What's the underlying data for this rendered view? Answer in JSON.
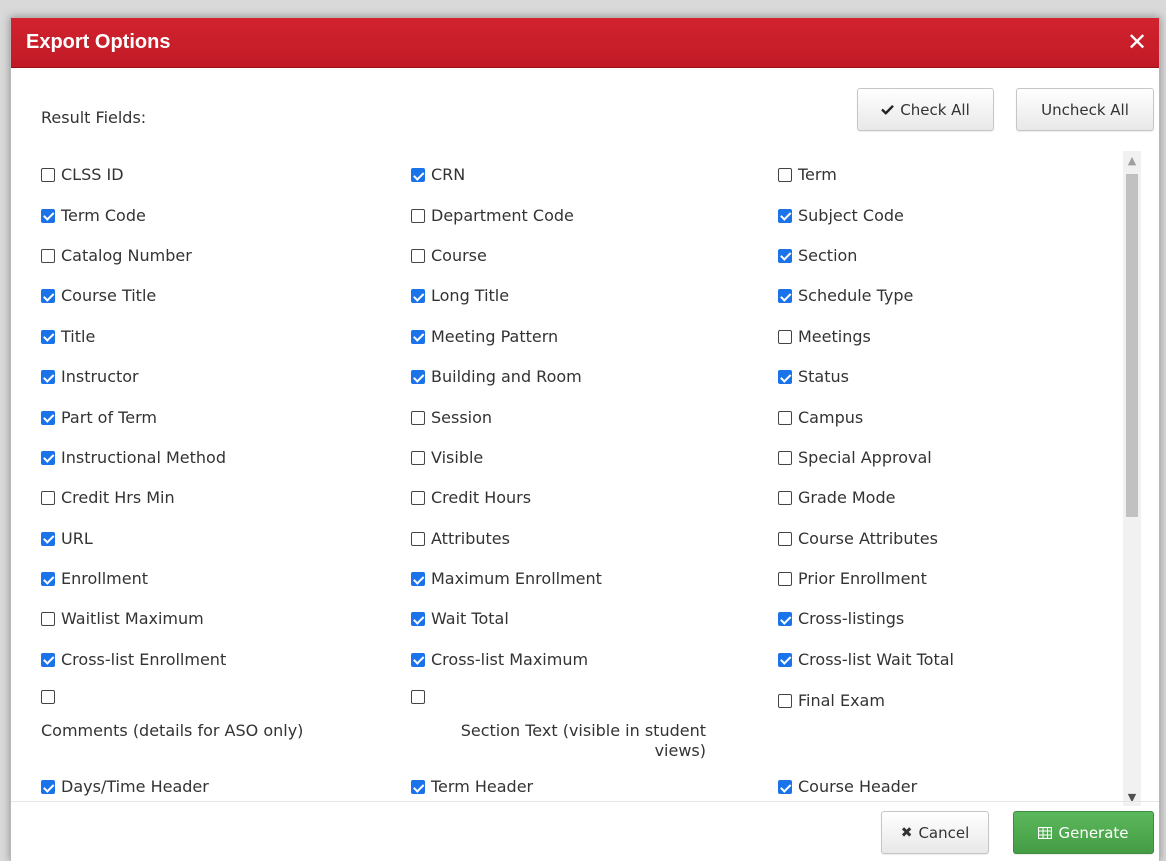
{
  "dialog": {
    "title": "Export Options",
    "close_glyph": "✕",
    "result_fields_label": "Result Fields:",
    "check_all_label": "Check All",
    "uncheck_all_label": "Uncheck All",
    "cancel_label": "Cancel",
    "generate_label": "Generate",
    "header_color": "#c8202c",
    "generate_color": "#4cae4c"
  },
  "fields": [
    {
      "label": "CLSS ID",
      "checked": false
    },
    {
      "label": "CRN",
      "checked": true
    },
    {
      "label": "Term",
      "checked": false
    },
    {
      "label": "Term Code",
      "checked": true
    },
    {
      "label": "Department Code",
      "checked": false
    },
    {
      "label": "Subject Code",
      "checked": true
    },
    {
      "label": "Catalog Number",
      "checked": false
    },
    {
      "label": "Course",
      "checked": false
    },
    {
      "label": "Section",
      "checked": true
    },
    {
      "label": "Course Title",
      "checked": true
    },
    {
      "label": "Long Title",
      "checked": true
    },
    {
      "label": "Schedule Type",
      "checked": true
    },
    {
      "label": "Title",
      "checked": true
    },
    {
      "label": "Meeting Pattern",
      "checked": true
    },
    {
      "label": "Meetings",
      "checked": false
    },
    {
      "label": "Instructor",
      "checked": true
    },
    {
      "label": "Building and Room",
      "checked": true
    },
    {
      "label": "Status",
      "checked": true
    },
    {
      "label": "Part of Term",
      "checked": true
    },
    {
      "label": "Session",
      "checked": false
    },
    {
      "label": "Campus",
      "checked": false
    },
    {
      "label": "Instructional Method",
      "checked": true
    },
    {
      "label": "Visible",
      "checked": false
    },
    {
      "label": "Special Approval",
      "checked": false
    },
    {
      "label": "Credit Hrs Min",
      "checked": false
    },
    {
      "label": "Credit Hours",
      "checked": false
    },
    {
      "label": "Grade Mode",
      "checked": false
    },
    {
      "label": "URL",
      "checked": true
    },
    {
      "label": "Attributes",
      "checked": false
    },
    {
      "label": "Course Attributes",
      "checked": false
    },
    {
      "label": "Enrollment",
      "checked": true
    },
    {
      "label": "Maximum Enrollment",
      "checked": true
    },
    {
      "label": "Prior Enrollment",
      "checked": false
    },
    {
      "label": "Waitlist Maximum",
      "checked": false
    },
    {
      "label": "Wait Total",
      "checked": true
    },
    {
      "label": "Cross-listings",
      "checked": true
    },
    {
      "label": "Cross-list Enrollment",
      "checked": true
    },
    {
      "label": "Cross-list Maximum",
      "checked": true
    },
    {
      "label": "Cross-list Wait Total",
      "checked": true
    }
  ],
  "tall_fields": [
    {
      "label": "Comments (details for ASO only)",
      "checked": false,
      "align": "left"
    },
    {
      "label": "Section Text (visible in student views)",
      "checked": false,
      "align": "right"
    },
    {
      "label": "Final Exam",
      "checked": false,
      "align": "inline"
    }
  ],
  "partial_fields": [
    {
      "label": "Days/Time Header",
      "checked": true
    },
    {
      "label": "Term Header",
      "checked": true
    },
    {
      "label": "Course Header",
      "checked": true
    }
  ]
}
